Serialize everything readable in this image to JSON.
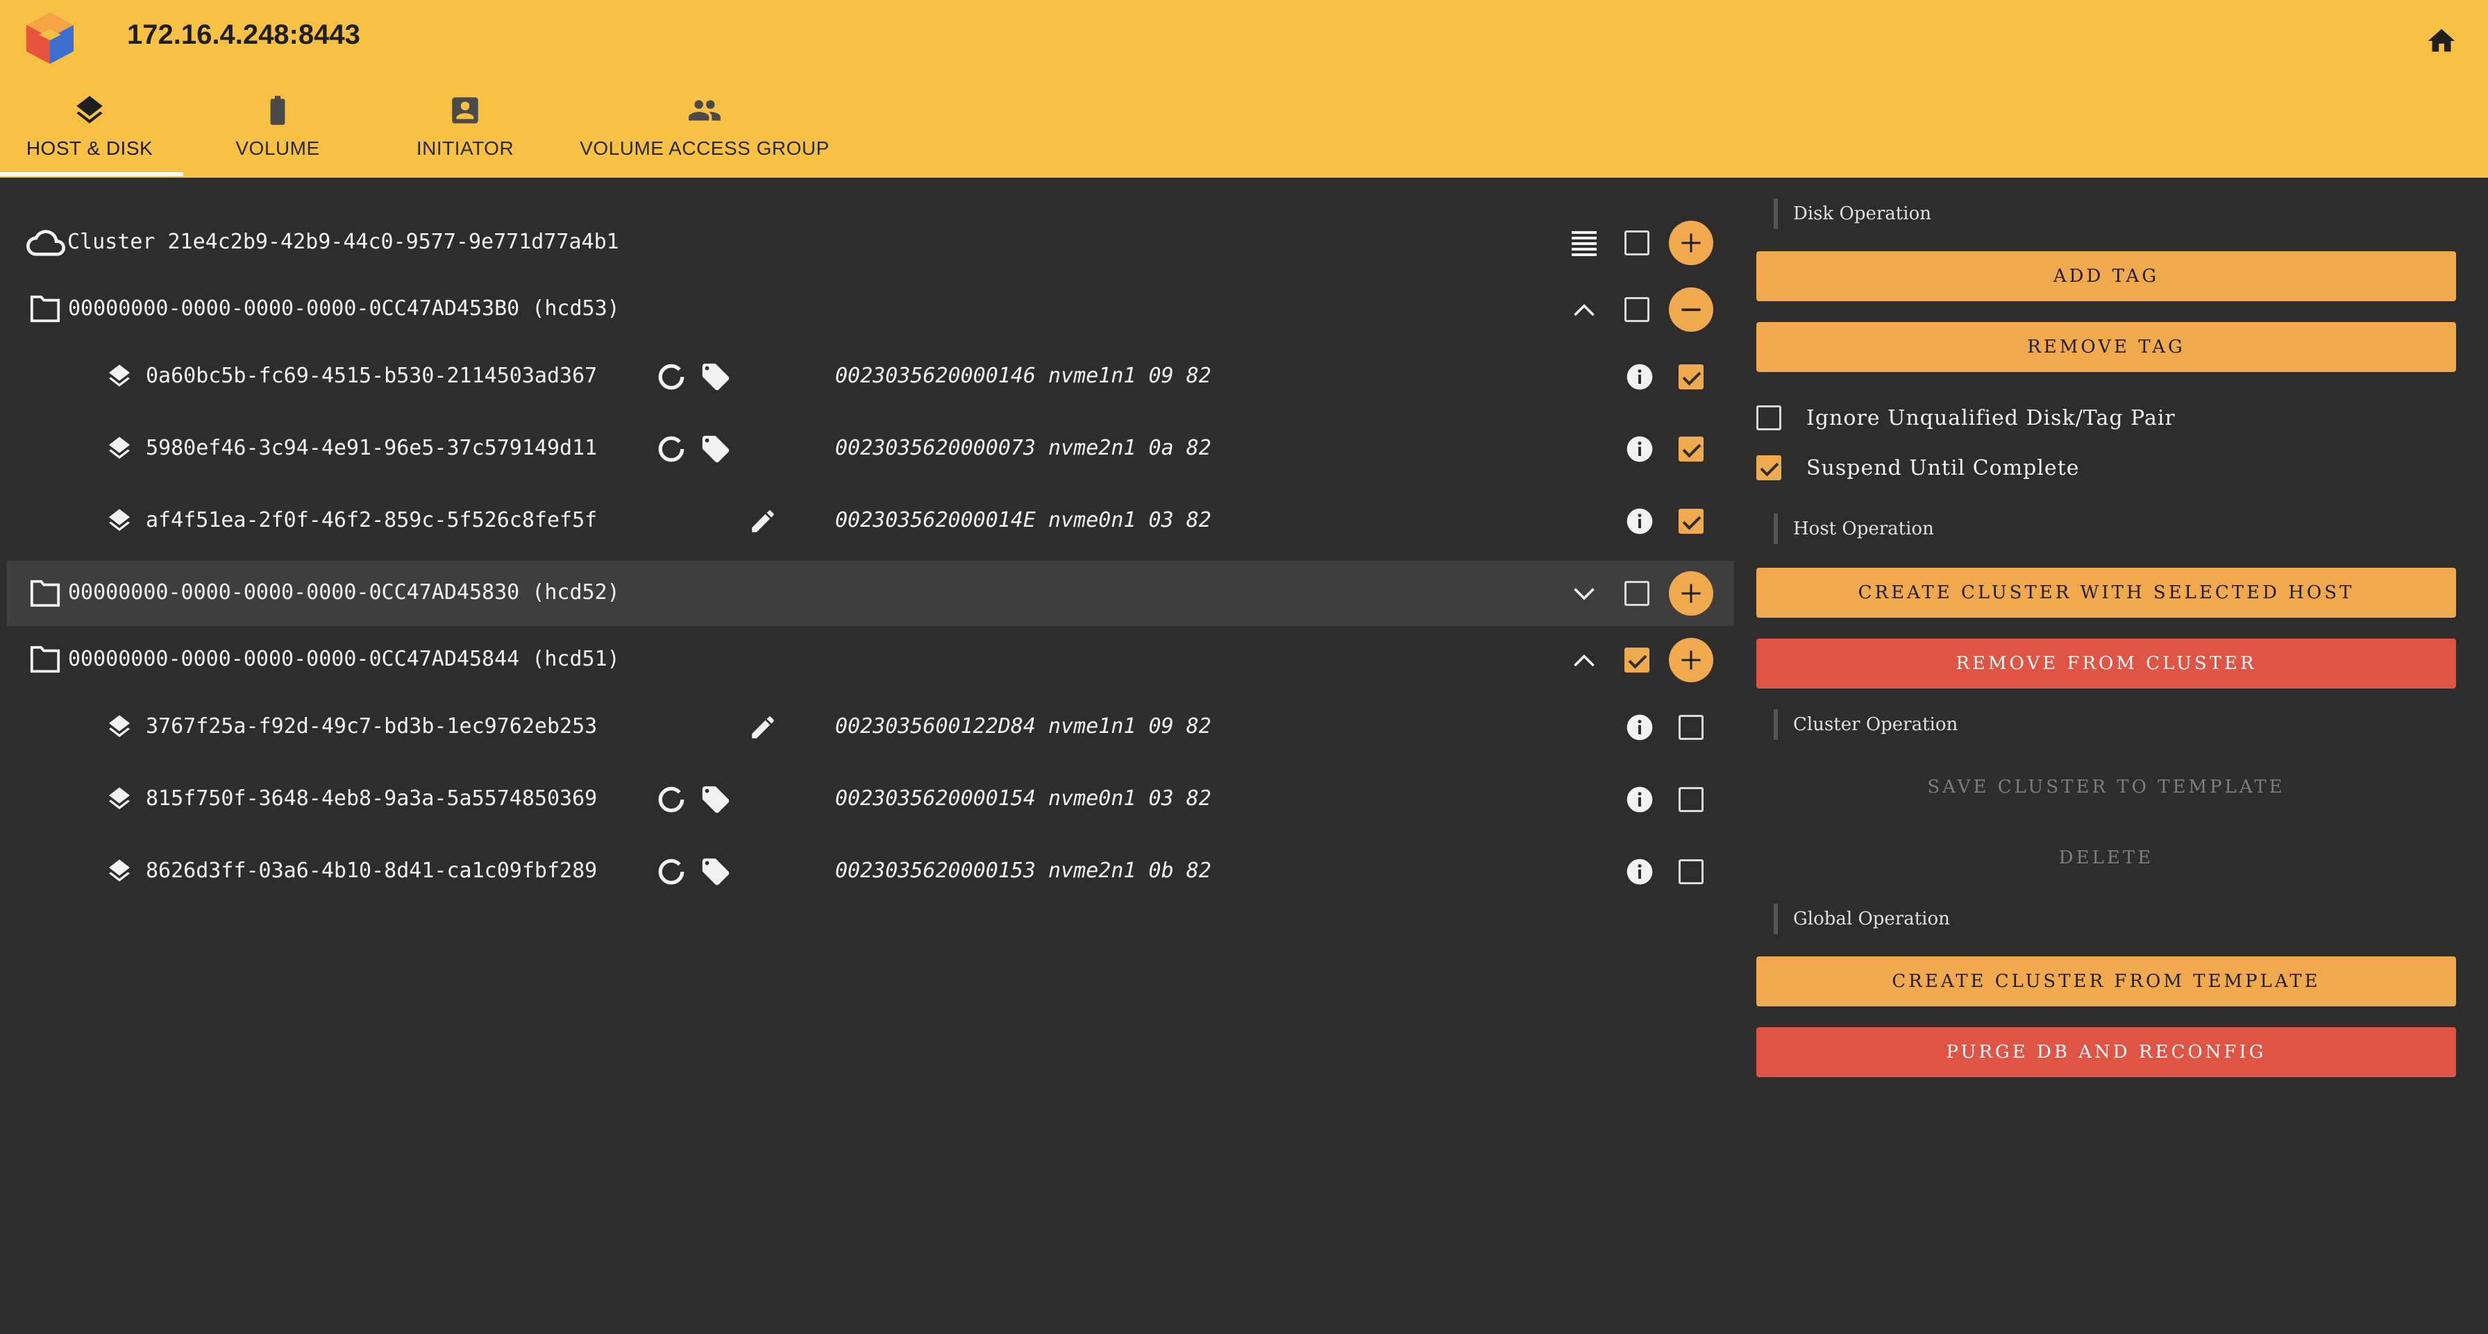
{
  "header": {
    "host": "172.16.4.248:8443",
    "tabs": [
      {
        "label": "HOST & DISK",
        "icon": "layers-icon",
        "active": true
      },
      {
        "label": "VOLUME",
        "icon": "battery-icon",
        "active": false
      },
      {
        "label": "INITIATOR",
        "icon": "account-box-icon",
        "active": false
      },
      {
        "label": "VOLUME ACCESS GROUP",
        "icon": "group-icon",
        "active": false
      }
    ]
  },
  "tree": {
    "cluster": {
      "label": "Cluster 21e4c2b9-42b9-44c0-9577-9e771d77a4b1",
      "checked": false
    },
    "hosts": [
      {
        "label": "00000000-0000-0000-0000-0CC47AD453B0 (hcd53)",
        "expanded": true,
        "checked": false,
        "action": "remove",
        "disks": [
          {
            "id": "0a60bc5b-fc69-4515-b530-2114503ad367",
            "meta": "0023035620000146 nvme1n1 09 82",
            "status": "tagged",
            "checked": true
          },
          {
            "id": "5980ef46-3c94-4e91-96e5-37c579149d11",
            "meta": "0023035620000073 nvme2n1 0a 82",
            "status": "tagged",
            "checked": true
          },
          {
            "id": "af4f51ea-2f0f-46f2-859c-5f526c8fef5f",
            "meta": "002303562000014E nvme0n1 03 82",
            "status": "editable",
            "checked": true
          }
        ]
      },
      {
        "label": "00000000-0000-0000-0000-0CC47AD45830 (hcd52)",
        "expanded": false,
        "checked": false,
        "action": "add",
        "disks": []
      },
      {
        "label": "00000000-0000-0000-0000-0CC47AD45844 (hcd51)",
        "expanded": true,
        "checked": true,
        "action": "add",
        "disks": [
          {
            "id": "3767f25a-f92d-49c7-bd3b-1ec9762eb253",
            "meta": "0023035600122D84 nvme1n1 09 82",
            "status": "editable",
            "checked": false
          },
          {
            "id": "815f750f-3648-4eb8-9a3a-5a5574850369",
            "meta": "0023035620000154 nvme0n1 03 82",
            "status": "tagged",
            "checked": false
          },
          {
            "id": "8626d3ff-03a6-4b10-8d41-ca1c09fbf289",
            "meta": "0023035620000153 nvme2n1 0b 82",
            "status": "tagged",
            "checked": false
          }
        ]
      }
    ]
  },
  "panel": {
    "disk_op_label": "Disk Operation",
    "add_tag": "ADD TAG",
    "remove_tag": "REMOVE TAG",
    "ignore_label": "Ignore Unqualified Disk/Tag Pair",
    "ignore_checked": false,
    "suspend_label": "Suspend Until Complete",
    "suspend_checked": true,
    "host_op_label": "Host Operation",
    "create_with_host": "CREATE CLUSTER WITH SELECTED HOST",
    "remove_from_cluster": "REMOVE FROM CLUSTER",
    "cluster_op_label": "Cluster Operation",
    "save_template": "SAVE CLUSTER TO TEMPLATE",
    "delete": "DELETE",
    "global_op_label": "Global Operation",
    "create_from_template": "CREATE CLUSTER FROM TEMPLATE",
    "purge": "PURGE DB AND RECONFIG"
  },
  "colors": {
    "header": "#f8c143",
    "accent": "#f1a94e",
    "danger": "#e05445",
    "background": "#2d2d2d"
  }
}
